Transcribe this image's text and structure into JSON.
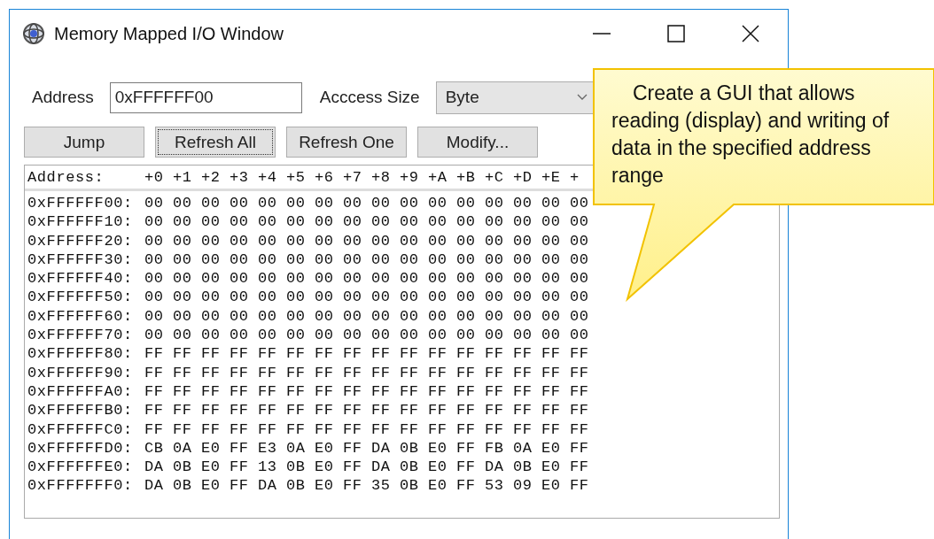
{
  "window": {
    "title": "Memory Mapped I/O Window"
  },
  "address_field": {
    "label": "Address",
    "value": "0xFFFFFF00"
  },
  "access_size": {
    "label": "Acccess Size",
    "value": "Byte"
  },
  "buttons": [
    {
      "label": "Jump",
      "focused": false
    },
    {
      "label": "Refresh All",
      "focused": true
    },
    {
      "label": "Refresh One",
      "focused": false
    },
    {
      "label": "Modify...",
      "focused": false
    }
  ],
  "dump": {
    "header_label": "Address:",
    "columns": [
      "+0",
      "+1",
      "+2",
      "+3",
      "+4",
      "+5",
      "+6",
      "+7",
      "+8",
      "+9",
      "+A",
      "+B",
      "+C",
      "+D",
      "+E",
      "+"
    ],
    "rows": [
      {
        "address": "0xFFFFFF00:",
        "bytes": [
          "00",
          "00",
          "00",
          "00",
          "00",
          "00",
          "00",
          "00",
          "00",
          "00",
          "00",
          "00",
          "00",
          "00",
          "00",
          "00"
        ]
      },
      {
        "address": "0xFFFFFF10:",
        "bytes": [
          "00",
          "00",
          "00",
          "00",
          "00",
          "00",
          "00",
          "00",
          "00",
          "00",
          "00",
          "00",
          "00",
          "00",
          "00",
          "00"
        ]
      },
      {
        "address": "0xFFFFFF20:",
        "bytes": [
          "00",
          "00",
          "00",
          "00",
          "00",
          "00",
          "00",
          "00",
          "00",
          "00",
          "00",
          "00",
          "00",
          "00",
          "00",
          "00"
        ]
      },
      {
        "address": "0xFFFFFF30:",
        "bytes": [
          "00",
          "00",
          "00",
          "00",
          "00",
          "00",
          "00",
          "00",
          "00",
          "00",
          "00",
          "00",
          "00",
          "00",
          "00",
          "00"
        ]
      },
      {
        "address": "0xFFFFFF40:",
        "bytes": [
          "00",
          "00",
          "00",
          "00",
          "00",
          "00",
          "00",
          "00",
          "00",
          "00",
          "00",
          "00",
          "00",
          "00",
          "00",
          "00"
        ]
      },
      {
        "address": "0xFFFFFF50:",
        "bytes": [
          "00",
          "00",
          "00",
          "00",
          "00",
          "00",
          "00",
          "00",
          "00",
          "00",
          "00",
          "00",
          "00",
          "00",
          "00",
          "00"
        ]
      },
      {
        "address": "0xFFFFFF60:",
        "bytes": [
          "00",
          "00",
          "00",
          "00",
          "00",
          "00",
          "00",
          "00",
          "00",
          "00",
          "00",
          "00",
          "00",
          "00",
          "00",
          "00"
        ]
      },
      {
        "address": "0xFFFFFF70:",
        "bytes": [
          "00",
          "00",
          "00",
          "00",
          "00",
          "00",
          "00",
          "00",
          "00",
          "00",
          "00",
          "00",
          "00",
          "00",
          "00",
          "00"
        ]
      },
      {
        "address": "0xFFFFFF80:",
        "bytes": [
          "FF",
          "FF",
          "FF",
          "FF",
          "FF",
          "FF",
          "FF",
          "FF",
          "FF",
          "FF",
          "FF",
          "FF",
          "FF",
          "FF",
          "FF",
          "FF"
        ]
      },
      {
        "address": "0xFFFFFF90:",
        "bytes": [
          "FF",
          "FF",
          "FF",
          "FF",
          "FF",
          "FF",
          "FF",
          "FF",
          "FF",
          "FF",
          "FF",
          "FF",
          "FF",
          "FF",
          "FF",
          "FF"
        ]
      },
      {
        "address": "0xFFFFFFA0:",
        "bytes": [
          "FF",
          "FF",
          "FF",
          "FF",
          "FF",
          "FF",
          "FF",
          "FF",
          "FF",
          "FF",
          "FF",
          "FF",
          "FF",
          "FF",
          "FF",
          "FF"
        ]
      },
      {
        "address": "0xFFFFFFB0:",
        "bytes": [
          "FF",
          "FF",
          "FF",
          "FF",
          "FF",
          "FF",
          "FF",
          "FF",
          "FF",
          "FF",
          "FF",
          "FF",
          "FF",
          "FF",
          "FF",
          "FF"
        ]
      },
      {
        "address": "0xFFFFFFC0:",
        "bytes": [
          "FF",
          "FF",
          "FF",
          "FF",
          "FF",
          "FF",
          "FF",
          "FF",
          "FF",
          "FF",
          "FF",
          "FF",
          "FF",
          "FF",
          "FF",
          "FF"
        ]
      },
      {
        "address": "0xFFFFFFD0:",
        "bytes": [
          "CB",
          "0A",
          "E0",
          "FF",
          "E3",
          "0A",
          "E0",
          "FF",
          "DA",
          "0B",
          "E0",
          "FF",
          "FB",
          "0A",
          "E0",
          "FF"
        ]
      },
      {
        "address": "0xFFFFFFE0:",
        "bytes": [
          "DA",
          "0B",
          "E0",
          "FF",
          "13",
          "0B",
          "E0",
          "FF",
          "DA",
          "0B",
          "E0",
          "FF",
          "DA",
          "0B",
          "E0",
          "FF"
        ]
      },
      {
        "address": "0xFFFFFFF0:",
        "bytes": [
          "DA",
          "0B",
          "E0",
          "FF",
          "DA",
          "0B",
          "E0",
          "FF",
          "35",
          "0B",
          "E0",
          "FF",
          "53",
          "09",
          "E0",
          "FF"
        ]
      }
    ]
  },
  "callout": {
    "text": "Create a GUI that allows reading (display) and writing of data in the specified address range"
  }
}
